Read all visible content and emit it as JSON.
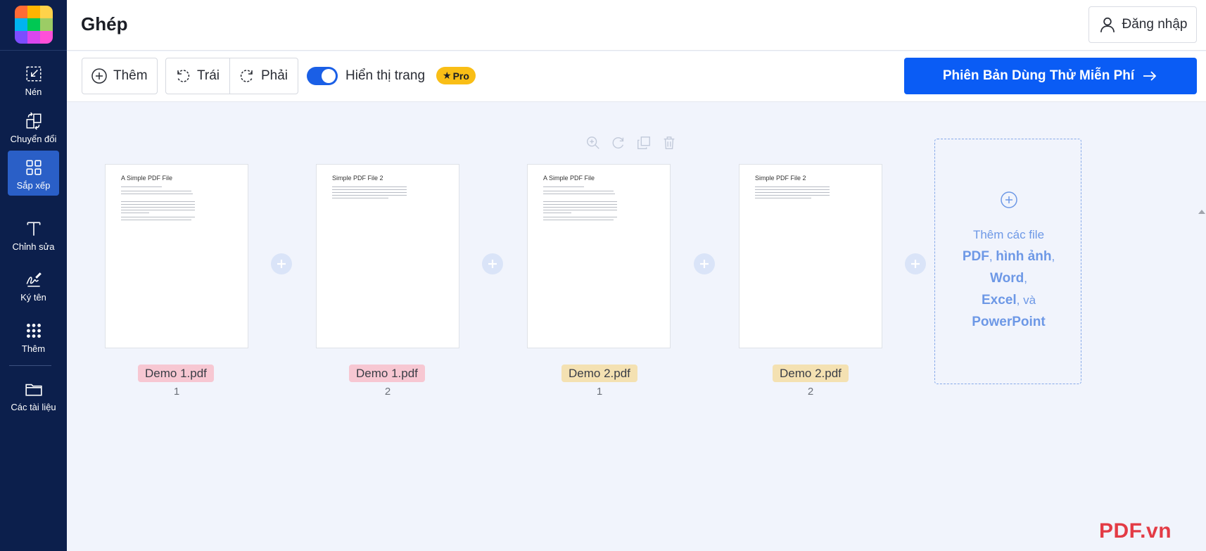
{
  "sidebar": {
    "logo_colors": [
      "#ff6b35",
      "#ffb400",
      "#ffd24a",
      "#00b4f0",
      "#00c853",
      "#9ccc65",
      "#7c4dff",
      "#d946ef",
      "#ff4fd8"
    ],
    "items": [
      {
        "label": "Nén",
        "icon": "compress-icon"
      },
      {
        "label": "Chuyển đổi",
        "icon": "convert-icon"
      },
      {
        "label": "Sắp xếp",
        "icon": "grid-icon",
        "active": true
      },
      {
        "label": "Chỉnh sửa",
        "icon": "text-icon"
      },
      {
        "label": "Ký tên",
        "icon": "signature-icon"
      },
      {
        "label": "Thêm",
        "icon": "dots-grid-icon"
      },
      {
        "label": "Các tài liệu",
        "icon": "folder-icon"
      }
    ]
  },
  "header": {
    "title": "Ghép",
    "login_label": "Đăng nhập"
  },
  "toolbar": {
    "add_label": "Thêm",
    "rotate_left_label": "Trái",
    "rotate_right_label": "Phải",
    "show_pages_label": "Hiển thị trang",
    "show_pages_enabled": true,
    "pro_label": "Pro",
    "trial_label": "Phiên Bản Dùng Thử Miễn Phí"
  },
  "pages": [
    {
      "thumb_title": "A Simple PDF File",
      "file": "Demo 1.pdf",
      "page": "1",
      "tag_color": "#f7c7d2"
    },
    {
      "thumb_title": "Simple PDF File 2",
      "file": "Demo 1.pdf",
      "page": "2",
      "tag_color": "#f7c7d2"
    },
    {
      "thumb_title": "A Simple PDF File",
      "file": "Demo 2.pdf",
      "page": "1",
      "tag_color": "#f4e1b2"
    },
    {
      "thumb_title": "Simple PDF File 2",
      "file": "Demo 2.pdf",
      "page": "2",
      "tag_color": "#f4e1b2"
    }
  ],
  "add_files": {
    "line1": "Thêm các file",
    "pdf": "PDF",
    "images": "hình ảnh",
    "word": "Word",
    "excel": "Excel",
    "and": "và",
    "powerpoint": "PowerPoint"
  },
  "watermark": "PDF.vn",
  "colors": {
    "sidebar_bg": "#0c1f4c",
    "active_nav": "#2a5fc7",
    "primary": "#0a5cf5",
    "pro_badge": "#f9be16",
    "workspace_bg": "#f1f4fc",
    "watermark": "#e33b45"
  }
}
